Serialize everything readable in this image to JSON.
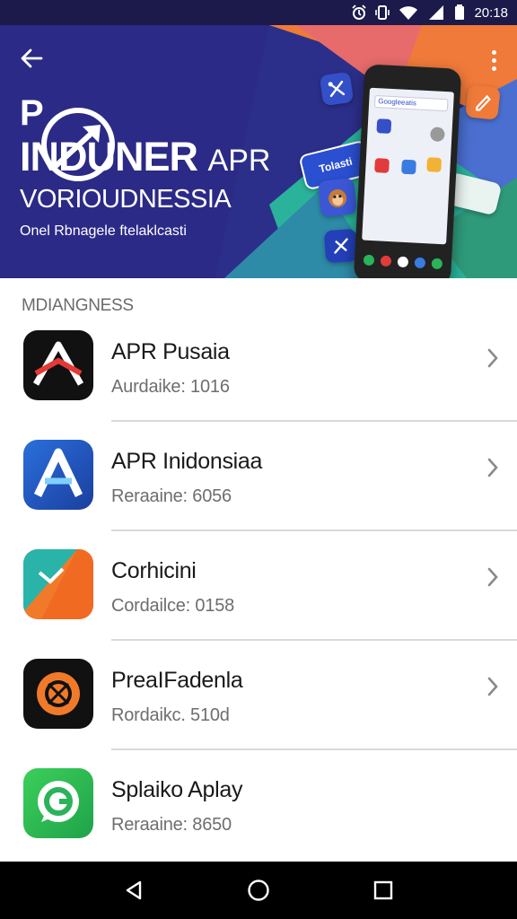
{
  "status_bar": {
    "time": "20:18",
    "icons": [
      "alarm-icon",
      "vibrate-icon",
      "wifi-icon",
      "signal-icon",
      "battery-icon"
    ]
  },
  "hero": {
    "title_bold": "INDUNER",
    "title_thin": "APR",
    "logo_letter": "P",
    "subtitle": "VORIOUDNESSIA",
    "tagline": "Onel Rbnagele ftelaklcasti",
    "phone_search_text": "Googleeatis",
    "card_label": "Tolasti"
  },
  "section": {
    "title": "MDIANGNESS"
  },
  "apps": [
    {
      "name": "APR Pusaia",
      "meta": "Aurdaike: 1016",
      "icon": "apr-logo-icon"
    },
    {
      "name": "APR Inidonsiaa",
      "meta": "Reraaine: 6056",
      "icon": "letter-a-icon"
    },
    {
      "name": "Corhicini",
      "meta": "Cordailce: 0158",
      "icon": "folded-paper-icon"
    },
    {
      "name": "PreaIFadenla",
      "meta": "Rordaikc. 510d",
      "icon": "orange-disc-icon"
    },
    {
      "name": "Splaiko Aplay",
      "meta": "Reraaine: 8650",
      "icon": "chat-bubble-icon"
    }
  ],
  "colors": {
    "hero_blue": "#2c2f8a",
    "hero_orange": "#f07a3a",
    "hero_green": "#2ab39a",
    "status_bar": "#1c1a4a",
    "nav_bar": "#000000",
    "divider": "#d9d9d9"
  },
  "nav_bar": {
    "buttons": [
      "back-triangle-icon",
      "home-circle-icon",
      "recents-square-icon"
    ]
  }
}
